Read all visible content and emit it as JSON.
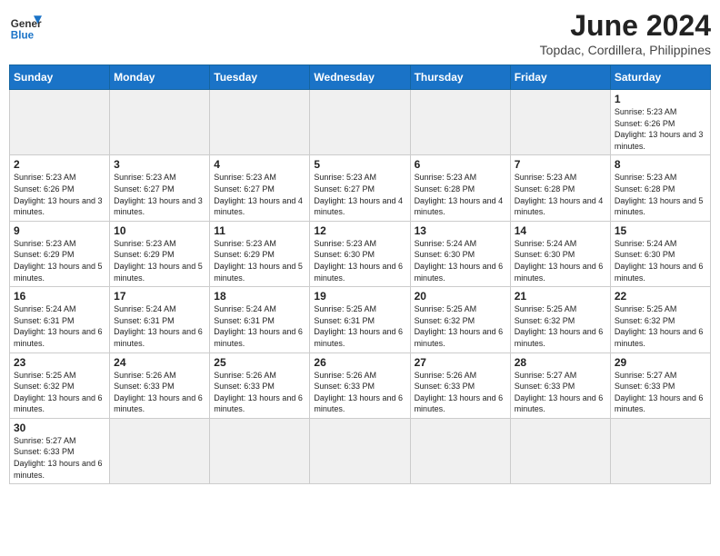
{
  "header": {
    "logo_general": "General",
    "logo_blue": "Blue",
    "title": "June 2024",
    "subtitle": "Topdac, Cordillera, Philippines"
  },
  "days_of_week": [
    "Sunday",
    "Monday",
    "Tuesday",
    "Wednesday",
    "Thursday",
    "Friday",
    "Saturday"
  ],
  "weeks": [
    [
      {
        "day": "",
        "info": "",
        "empty": true
      },
      {
        "day": "",
        "info": "",
        "empty": true
      },
      {
        "day": "",
        "info": "",
        "empty": true
      },
      {
        "day": "",
        "info": "",
        "empty": true
      },
      {
        "day": "",
        "info": "",
        "empty": true
      },
      {
        "day": "",
        "info": "",
        "empty": true
      },
      {
        "day": "1",
        "info": "Sunrise: 5:23 AM\nSunset: 6:26 PM\nDaylight: 13 hours and 3 minutes."
      }
    ],
    [
      {
        "day": "2",
        "info": "Sunrise: 5:23 AM\nSunset: 6:26 PM\nDaylight: 13 hours and 3 minutes."
      },
      {
        "day": "3",
        "info": "Sunrise: 5:23 AM\nSunset: 6:27 PM\nDaylight: 13 hours and 3 minutes."
      },
      {
        "day": "4",
        "info": "Sunrise: 5:23 AM\nSunset: 6:27 PM\nDaylight: 13 hours and 4 minutes."
      },
      {
        "day": "5",
        "info": "Sunrise: 5:23 AM\nSunset: 6:27 PM\nDaylight: 13 hours and 4 minutes."
      },
      {
        "day": "6",
        "info": "Sunrise: 5:23 AM\nSunset: 6:28 PM\nDaylight: 13 hours and 4 minutes."
      },
      {
        "day": "7",
        "info": "Sunrise: 5:23 AM\nSunset: 6:28 PM\nDaylight: 13 hours and 4 minutes."
      },
      {
        "day": "8",
        "info": "Sunrise: 5:23 AM\nSunset: 6:28 PM\nDaylight: 13 hours and 5 minutes."
      }
    ],
    [
      {
        "day": "9",
        "info": "Sunrise: 5:23 AM\nSunset: 6:29 PM\nDaylight: 13 hours and 5 minutes."
      },
      {
        "day": "10",
        "info": "Sunrise: 5:23 AM\nSunset: 6:29 PM\nDaylight: 13 hours and 5 minutes."
      },
      {
        "day": "11",
        "info": "Sunrise: 5:23 AM\nSunset: 6:29 PM\nDaylight: 13 hours and 5 minutes."
      },
      {
        "day": "12",
        "info": "Sunrise: 5:23 AM\nSunset: 6:30 PM\nDaylight: 13 hours and 6 minutes."
      },
      {
        "day": "13",
        "info": "Sunrise: 5:24 AM\nSunset: 6:30 PM\nDaylight: 13 hours and 6 minutes."
      },
      {
        "day": "14",
        "info": "Sunrise: 5:24 AM\nSunset: 6:30 PM\nDaylight: 13 hours and 6 minutes."
      },
      {
        "day": "15",
        "info": "Sunrise: 5:24 AM\nSunset: 6:30 PM\nDaylight: 13 hours and 6 minutes."
      }
    ],
    [
      {
        "day": "16",
        "info": "Sunrise: 5:24 AM\nSunset: 6:31 PM\nDaylight: 13 hours and 6 minutes."
      },
      {
        "day": "17",
        "info": "Sunrise: 5:24 AM\nSunset: 6:31 PM\nDaylight: 13 hours and 6 minutes."
      },
      {
        "day": "18",
        "info": "Sunrise: 5:24 AM\nSunset: 6:31 PM\nDaylight: 13 hours and 6 minutes."
      },
      {
        "day": "19",
        "info": "Sunrise: 5:25 AM\nSunset: 6:31 PM\nDaylight: 13 hours and 6 minutes."
      },
      {
        "day": "20",
        "info": "Sunrise: 5:25 AM\nSunset: 6:32 PM\nDaylight: 13 hours and 6 minutes."
      },
      {
        "day": "21",
        "info": "Sunrise: 5:25 AM\nSunset: 6:32 PM\nDaylight: 13 hours and 6 minutes."
      },
      {
        "day": "22",
        "info": "Sunrise: 5:25 AM\nSunset: 6:32 PM\nDaylight: 13 hours and 6 minutes."
      }
    ],
    [
      {
        "day": "23",
        "info": "Sunrise: 5:25 AM\nSunset: 6:32 PM\nDaylight: 13 hours and 6 minutes."
      },
      {
        "day": "24",
        "info": "Sunrise: 5:26 AM\nSunset: 6:33 PM\nDaylight: 13 hours and 6 minutes."
      },
      {
        "day": "25",
        "info": "Sunrise: 5:26 AM\nSunset: 6:33 PM\nDaylight: 13 hours and 6 minutes."
      },
      {
        "day": "26",
        "info": "Sunrise: 5:26 AM\nSunset: 6:33 PM\nDaylight: 13 hours and 6 minutes."
      },
      {
        "day": "27",
        "info": "Sunrise: 5:26 AM\nSunset: 6:33 PM\nDaylight: 13 hours and 6 minutes."
      },
      {
        "day": "28",
        "info": "Sunrise: 5:27 AM\nSunset: 6:33 PM\nDaylight: 13 hours and 6 minutes."
      },
      {
        "day": "29",
        "info": "Sunrise: 5:27 AM\nSunset: 6:33 PM\nDaylight: 13 hours and 6 minutes."
      }
    ],
    [
      {
        "day": "30",
        "info": "Sunrise: 5:27 AM\nSunset: 6:33 PM\nDaylight: 13 hours and 6 minutes.",
        "last": true
      },
      {
        "day": "",
        "info": "",
        "empty": true,
        "last": true
      },
      {
        "day": "",
        "info": "",
        "empty": true,
        "last": true
      },
      {
        "day": "",
        "info": "",
        "empty": true,
        "last": true
      },
      {
        "day": "",
        "info": "",
        "empty": true,
        "last": true
      },
      {
        "day": "",
        "info": "",
        "empty": true,
        "last": true
      },
      {
        "day": "",
        "info": "",
        "empty": true,
        "last": true
      }
    ]
  ]
}
